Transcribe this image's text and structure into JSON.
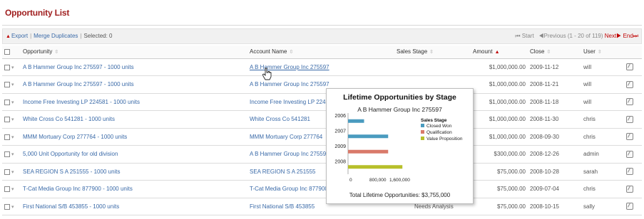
{
  "page": {
    "title": "Opportunity List"
  },
  "toolbar": {
    "export_label": "Export",
    "merge_label": "Merge Duplicates",
    "separator": "|",
    "selected_label": "Selected: 0",
    "start_label": "Start",
    "previous_label": "Previous",
    "range_label": "(1 - 20 of 119)",
    "next_label": "Next",
    "end_label": "End"
  },
  "table": {
    "columns": {
      "opportunity": "Opportunity",
      "account": "Account Name",
      "stage": "Sales Stage",
      "amount": "Amount",
      "close": "Close",
      "user": "User"
    },
    "rows": [
      {
        "opportunity": "A B Hammer Group Inc 275597 - 1000 units",
        "account": "A B Hammer Group Inc 275597",
        "stage": "",
        "amount": "$1,000,000.00",
        "close": "2009-11-12",
        "user": "will"
      },
      {
        "opportunity": "A B Hammer Group Inc 275597 - 1000 units",
        "account": "A B Hammer Group Inc 275597",
        "stage": "",
        "amount": "$1,000,000.00",
        "close": "2008-11-21",
        "user": "will"
      },
      {
        "opportunity": "Income Free Investing LP 224581 - 1000 units",
        "account": "Income Free Investing LP 224581",
        "stage": "",
        "amount": "$1,000,000.00",
        "close": "2008-11-18",
        "user": "will"
      },
      {
        "opportunity": "White Cross Co 541281 - 1000 units",
        "account": "White Cross Co 541281",
        "stage": "",
        "amount": "$1,000,000.00",
        "close": "2008-11-30",
        "user": "chris"
      },
      {
        "opportunity": "MMM Mortuary Corp 277764 - 1000 units",
        "account": "MMM Mortuary Corp 277764",
        "stage": "",
        "amount": "$1,000,000.00",
        "close": "2008-09-30",
        "user": "chris"
      },
      {
        "opportunity": "5,000 Unit Opportunity for old division",
        "account": "A B Hammer Group Inc 275597",
        "stage": "",
        "amount": "$300,000.00",
        "close": "2008-12-26",
        "user": "admin"
      },
      {
        "opportunity": "SEA REGION S A 251555 - 1000 units",
        "account": "SEA REGION S A 251555",
        "stage": "",
        "amount": "$75,000.00",
        "close": "2008-10-28",
        "user": "sarah"
      },
      {
        "opportunity": "T-Cat Media Group Inc 877900 - 1000 units",
        "account": "T-Cat Media Group Inc 877900",
        "stage": "",
        "amount": "$75,000.00",
        "close": "2009-07-04",
        "user": "chris"
      },
      {
        "opportunity": "First National S/B 453855 - 1000 units",
        "account": "First National S/B 453855",
        "stage": "Needs Analysis",
        "amount": "$75,000.00",
        "close": "2008-10-15",
        "user": "sally"
      }
    ]
  },
  "popup": {
    "title": "Lifetime Opportunities by Stage",
    "subtitle": "A B Hammer Group Inc 275597",
    "footer": "Total Lifetime Opportunities: $3,755,000"
  },
  "chart_data": {
    "type": "bar",
    "orientation": "horizontal",
    "stacked": true,
    "title": "Lifetime Opportunities by Stage",
    "subtitle": "A B Hammer Group Inc 275597",
    "categories": [
      "2006",
      "2007",
      "2009",
      "2008"
    ],
    "legend_title": "Sales Stage",
    "legend_placement": "right",
    "series": [
      {
        "name": "Closed Won",
        "color": "#4a9bbf",
        "values": [
          400000,
          1000000,
          0,
          0
        ]
      },
      {
        "name": "Qualification",
        "color": "#d97a6a",
        "values": [
          0,
          0,
          1000000,
          0
        ]
      },
      {
        "name": "Value Proposition",
        "color": "#b7bf2a",
        "values": [
          0,
          0,
          0,
          1355000
        ]
      }
    ],
    "xticks": [
      "0",
      "800,000",
      "1,600,000"
    ],
    "xlim": [
      0,
      1600000
    ],
    "grid": false
  },
  "colors": {
    "title": "#a02020",
    "link": "#3a6aa8",
    "accent_red": "#c00000"
  }
}
